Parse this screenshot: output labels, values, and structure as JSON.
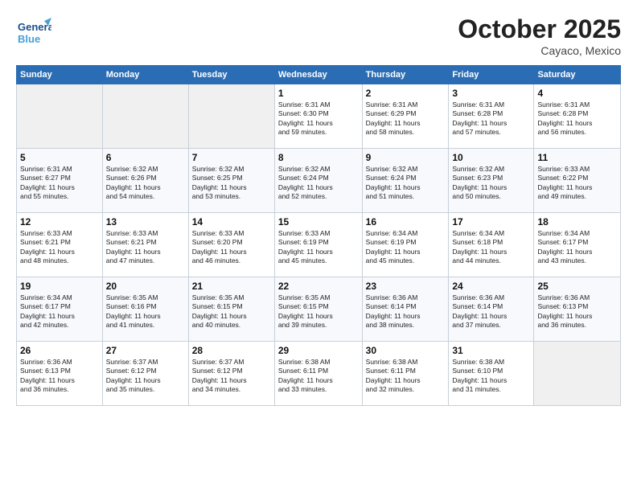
{
  "logo": {
    "line1": "General",
    "line2": "Blue"
  },
  "header": {
    "month": "October 2025",
    "location": "Cayaco, Mexico"
  },
  "weekdays": [
    "Sunday",
    "Monday",
    "Tuesday",
    "Wednesday",
    "Thursday",
    "Friday",
    "Saturday"
  ],
  "weeks": [
    [
      {
        "day": "",
        "info": ""
      },
      {
        "day": "",
        "info": ""
      },
      {
        "day": "",
        "info": ""
      },
      {
        "day": "1",
        "info": "Sunrise: 6:31 AM\nSunset: 6:30 PM\nDaylight: 11 hours\nand 59 minutes."
      },
      {
        "day": "2",
        "info": "Sunrise: 6:31 AM\nSunset: 6:29 PM\nDaylight: 11 hours\nand 58 minutes."
      },
      {
        "day": "3",
        "info": "Sunrise: 6:31 AM\nSunset: 6:28 PM\nDaylight: 11 hours\nand 57 minutes."
      },
      {
        "day": "4",
        "info": "Sunrise: 6:31 AM\nSunset: 6:28 PM\nDaylight: 11 hours\nand 56 minutes."
      }
    ],
    [
      {
        "day": "5",
        "info": "Sunrise: 6:31 AM\nSunset: 6:27 PM\nDaylight: 11 hours\nand 55 minutes."
      },
      {
        "day": "6",
        "info": "Sunrise: 6:32 AM\nSunset: 6:26 PM\nDaylight: 11 hours\nand 54 minutes."
      },
      {
        "day": "7",
        "info": "Sunrise: 6:32 AM\nSunset: 6:25 PM\nDaylight: 11 hours\nand 53 minutes."
      },
      {
        "day": "8",
        "info": "Sunrise: 6:32 AM\nSunset: 6:24 PM\nDaylight: 11 hours\nand 52 minutes."
      },
      {
        "day": "9",
        "info": "Sunrise: 6:32 AM\nSunset: 6:24 PM\nDaylight: 11 hours\nand 51 minutes."
      },
      {
        "day": "10",
        "info": "Sunrise: 6:32 AM\nSunset: 6:23 PM\nDaylight: 11 hours\nand 50 minutes."
      },
      {
        "day": "11",
        "info": "Sunrise: 6:33 AM\nSunset: 6:22 PM\nDaylight: 11 hours\nand 49 minutes."
      }
    ],
    [
      {
        "day": "12",
        "info": "Sunrise: 6:33 AM\nSunset: 6:21 PM\nDaylight: 11 hours\nand 48 minutes."
      },
      {
        "day": "13",
        "info": "Sunrise: 6:33 AM\nSunset: 6:21 PM\nDaylight: 11 hours\nand 47 minutes."
      },
      {
        "day": "14",
        "info": "Sunrise: 6:33 AM\nSunset: 6:20 PM\nDaylight: 11 hours\nand 46 minutes."
      },
      {
        "day": "15",
        "info": "Sunrise: 6:33 AM\nSunset: 6:19 PM\nDaylight: 11 hours\nand 45 minutes."
      },
      {
        "day": "16",
        "info": "Sunrise: 6:34 AM\nSunset: 6:19 PM\nDaylight: 11 hours\nand 45 minutes."
      },
      {
        "day": "17",
        "info": "Sunrise: 6:34 AM\nSunset: 6:18 PM\nDaylight: 11 hours\nand 44 minutes."
      },
      {
        "day": "18",
        "info": "Sunrise: 6:34 AM\nSunset: 6:17 PM\nDaylight: 11 hours\nand 43 minutes."
      }
    ],
    [
      {
        "day": "19",
        "info": "Sunrise: 6:34 AM\nSunset: 6:17 PM\nDaylight: 11 hours\nand 42 minutes."
      },
      {
        "day": "20",
        "info": "Sunrise: 6:35 AM\nSunset: 6:16 PM\nDaylight: 11 hours\nand 41 minutes."
      },
      {
        "day": "21",
        "info": "Sunrise: 6:35 AM\nSunset: 6:15 PM\nDaylight: 11 hours\nand 40 minutes."
      },
      {
        "day": "22",
        "info": "Sunrise: 6:35 AM\nSunset: 6:15 PM\nDaylight: 11 hours\nand 39 minutes."
      },
      {
        "day": "23",
        "info": "Sunrise: 6:36 AM\nSunset: 6:14 PM\nDaylight: 11 hours\nand 38 minutes."
      },
      {
        "day": "24",
        "info": "Sunrise: 6:36 AM\nSunset: 6:14 PM\nDaylight: 11 hours\nand 37 minutes."
      },
      {
        "day": "25",
        "info": "Sunrise: 6:36 AM\nSunset: 6:13 PM\nDaylight: 11 hours\nand 36 minutes."
      }
    ],
    [
      {
        "day": "26",
        "info": "Sunrise: 6:36 AM\nSunset: 6:13 PM\nDaylight: 11 hours\nand 36 minutes."
      },
      {
        "day": "27",
        "info": "Sunrise: 6:37 AM\nSunset: 6:12 PM\nDaylight: 11 hours\nand 35 minutes."
      },
      {
        "day": "28",
        "info": "Sunrise: 6:37 AM\nSunset: 6:12 PM\nDaylight: 11 hours\nand 34 minutes."
      },
      {
        "day": "29",
        "info": "Sunrise: 6:38 AM\nSunset: 6:11 PM\nDaylight: 11 hours\nand 33 minutes."
      },
      {
        "day": "30",
        "info": "Sunrise: 6:38 AM\nSunset: 6:11 PM\nDaylight: 11 hours\nand 32 minutes."
      },
      {
        "day": "31",
        "info": "Sunrise: 6:38 AM\nSunset: 6:10 PM\nDaylight: 11 hours\nand 31 minutes."
      },
      {
        "day": "",
        "info": ""
      }
    ]
  ]
}
